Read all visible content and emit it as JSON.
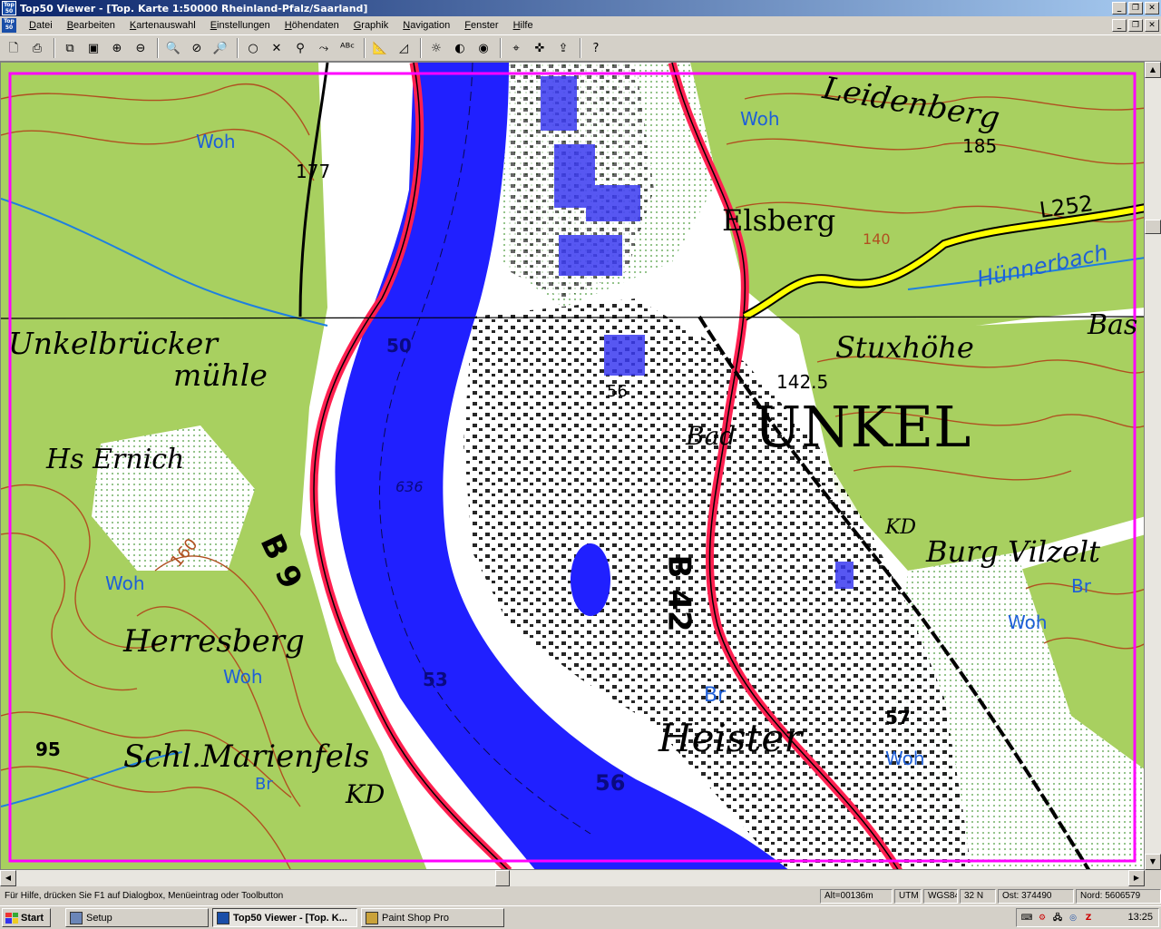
{
  "window": {
    "app_icon_text": "Top 50",
    "title": "Top50 Viewer - [Top. Karte 1:50000 Rheinland-Pfalz/Saarland]",
    "controls": [
      "_",
      "❐",
      "✕"
    ]
  },
  "menu": {
    "doc_icon_text": "Top 50",
    "items": [
      "Datei",
      "Bearbeiten",
      "Kartenauswahl",
      "Einstellungen",
      "Höhendaten",
      "Graphik",
      "Navigation",
      "Fenster",
      "Hilfe"
    ],
    "controls": [
      "_",
      "❐",
      "✕"
    ]
  },
  "toolbar": {
    "groups": [
      [
        {
          "name": "new-doc-icon",
          "glyph": "🗋"
        },
        {
          "name": "print-icon",
          "glyph": "⎙"
        }
      ],
      [
        {
          "name": "copy-map-icon",
          "glyph": "⧉"
        },
        {
          "name": "paste-map-icon",
          "glyph": "▣"
        },
        {
          "name": "zoom-overview-icon",
          "glyph": "⊕"
        },
        {
          "name": "zoom-detail-icon",
          "glyph": "⊖"
        }
      ],
      [
        {
          "name": "zoom-in-icon",
          "glyph": "🔍"
        },
        {
          "name": "zoom-cancel-icon",
          "glyph": "⊘"
        },
        {
          "name": "zoom-out-icon",
          "glyph": "🔎"
        }
      ],
      [
        {
          "name": "waypoint-icon",
          "glyph": "○"
        },
        {
          "name": "delete-waypoint-icon",
          "glyph": "✕"
        },
        {
          "name": "route-icon",
          "glyph": "⚲"
        },
        {
          "name": "route-edit-icon",
          "glyph": "⤳"
        },
        {
          "name": "route-label-icon",
          "glyph": "ᴬᴮᶜ"
        }
      ],
      [
        {
          "name": "measure-icon",
          "glyph": "📐"
        },
        {
          "name": "measure-area-icon",
          "glyph": "◿"
        }
      ],
      [
        {
          "name": "brightness-icon",
          "glyph": "☼"
        },
        {
          "name": "contrast-icon",
          "glyph": "◐"
        },
        {
          "name": "color-icon",
          "glyph": "◉"
        }
      ],
      [
        {
          "name": "gps-icon",
          "glyph": "⌖"
        },
        {
          "name": "gps-track-icon",
          "glyph": "✜"
        },
        {
          "name": "gps-send-icon",
          "glyph": "⇪"
        }
      ],
      [
        {
          "name": "context-help-icon",
          "glyph": "?"
        }
      ]
    ]
  },
  "map": {
    "border_color": "#ff00ff",
    "river_color": "#2020ff",
    "road_color": "#ff2050",
    "forest_color": "#a8d060",
    "contour_color": "#b05020",
    "labels": {
      "leidenberg": "Leidenberg",
      "elsberg": "Elsberg",
      "unkelbruecker": "Unkelbrücker",
      "muehle": "mühle",
      "stuxhoehe": "Stuxhöhe",
      "unkel": "UNKEL",
      "hs_ernich": "Hs Ernich",
      "herresberg": "Herresberg",
      "burg_vilzelt": "Burg Vilzelt",
      "heister": "Heister",
      "schl_marienfels": "Schl.Marienfels",
      "kd": "KD",
      "kd2": "KD",
      "bas": "Bas",
      "bad": "Bad",
      "b9": "B 9",
      "b42": "B 42",
      "l252": "L252",
      "huennerbach": "Hünnerbach",
      "woh_1": "Woh",
      "woh_2": "Woh",
      "woh_3": "Woh",
      "woh_4": "Woh",
      "woh_5": "Woh",
      "woh_6": "Woh",
      "br_1": "Br",
      "br_2": "Br",
      "br_3": "Br",
      "h_177": "177",
      "h_185": "185",
      "h_140": "140",
      "h_160": "160",
      "h_1425": "142.5",
      "h_95": "95",
      "h_57": "57",
      "h_56": "56",
      "h_56b": "56",
      "h_53": "53",
      "h_50": "50",
      "h_636": "636"
    }
  },
  "status": {
    "help": "Für Hilfe, drücken Sie F1 auf Dialogbox, Menüeintrag oder Toolbutton",
    "alt": "Alt=00136m",
    "system": "UTM",
    "datum": "WGS84",
    "zone": "32 N",
    "ost": "Ost:  374490",
    "nord": "Nord: 5606579"
  },
  "taskbar": {
    "start": "Start",
    "tasks": [
      "Setup",
      "Top50 Viewer - [Top. K...",
      "Paint Shop Pro"
    ],
    "tray_icons": [
      "⌨",
      "⚙",
      "🖧",
      "◎",
      "Z"
    ],
    "clock": "13:25"
  }
}
